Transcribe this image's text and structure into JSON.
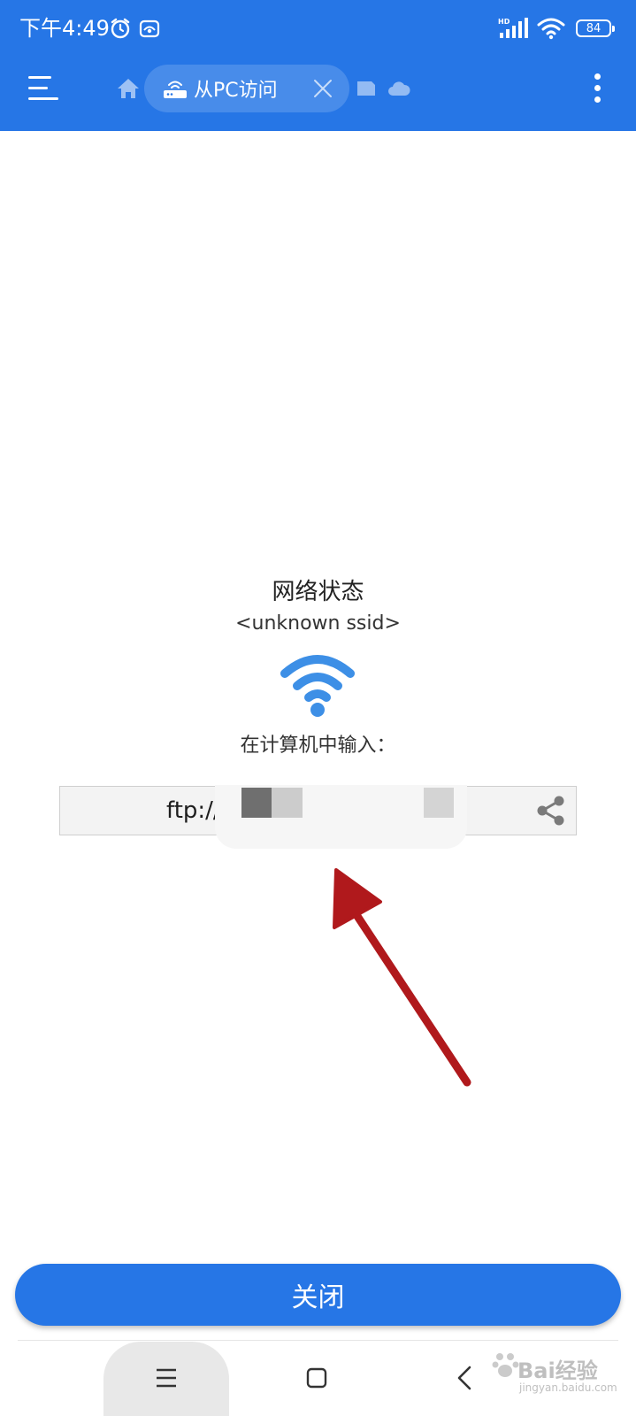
{
  "status_bar": {
    "time": "下午4:49",
    "network_badge": "HD",
    "battery_level": "84"
  },
  "toolbar": {
    "tab_label": "从PC访问"
  },
  "content": {
    "network_status_title": "网络状态",
    "ssid": "<unknown ssid>",
    "enter_hint": "在计算机中输入：",
    "ftp_address_visible": "ftp://1"
  },
  "close_button_label": "关闭",
  "watermark": {
    "brand": "Bai经验",
    "url": "jingyan.baidu.com"
  },
  "colors": {
    "accent": "#2676e6",
    "wifi_icon": "#3d8fe6",
    "annotation_arrow": "#b0191c"
  }
}
